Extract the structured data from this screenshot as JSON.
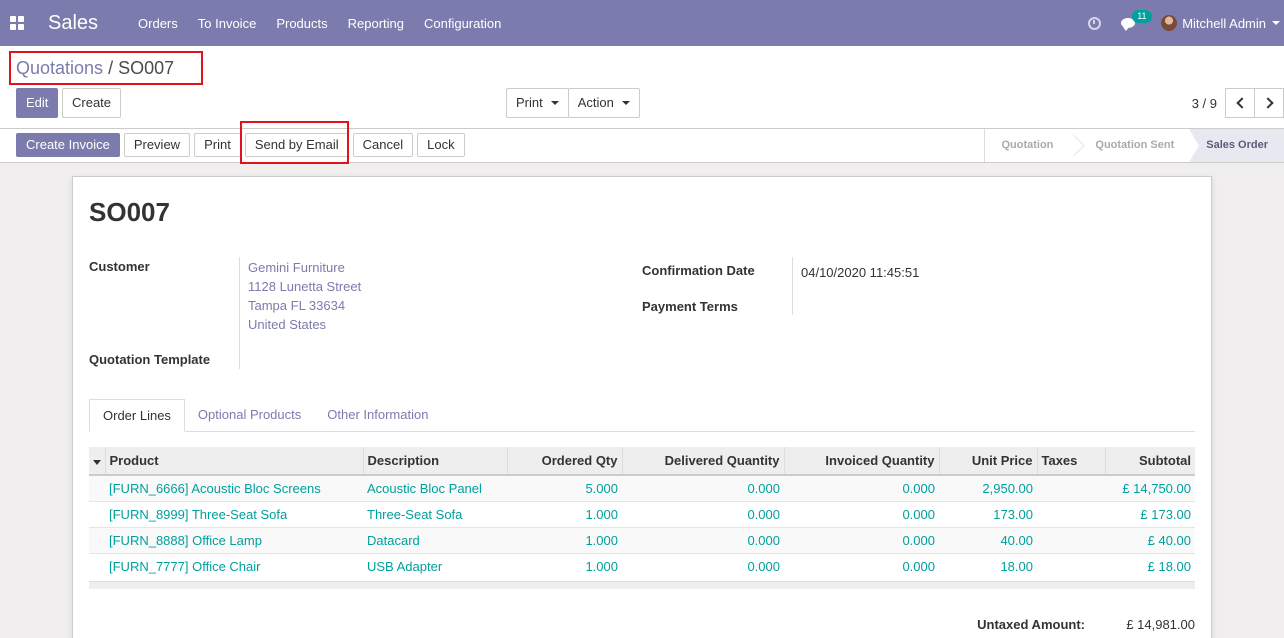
{
  "navbar": {
    "app_name": "Sales",
    "menu": [
      "Orders",
      "To Invoice",
      "Products",
      "Reporting",
      "Configuration"
    ],
    "chat_count": "11",
    "user_name": "Mitchell Admin"
  },
  "breadcrumb": {
    "parent": "Quotations",
    "separator": "/",
    "current": "SO007"
  },
  "toolbar": {
    "edit_label": "Edit",
    "create_label": "Create",
    "print_label": "Print",
    "action_label": "Action",
    "pager_value": "3 / 9"
  },
  "statusbar": {
    "buttons": [
      "Create Invoice",
      "Preview",
      "Print",
      "Send by Email",
      "Cancel",
      "Lock"
    ],
    "stages": [
      "Quotation",
      "Quotation Sent",
      "Sales Order"
    ],
    "active_stage": "Sales Order"
  },
  "form": {
    "title": "SO007",
    "customer_label": "Customer",
    "customer_address": [
      "Gemini Furniture",
      "1128 Lunetta Street",
      "Tampa FL 33634",
      "United States"
    ],
    "template_label": "Quotation Template",
    "confirmation_date_label": "Confirmation Date",
    "confirmation_date": "04/10/2020 11:45:51",
    "payment_terms_label": "Payment Terms"
  },
  "tabs": [
    "Order Lines",
    "Optional Products",
    "Other Information"
  ],
  "order_lines": {
    "headers": [
      "Product",
      "Description",
      "Ordered Qty",
      "Delivered Quantity",
      "Invoiced Quantity",
      "Unit Price",
      "Taxes",
      "Subtotal"
    ],
    "rows": [
      [
        "[FURN_6666] Acoustic Bloc Screens",
        "Acoustic Bloc Panel",
        "5.000",
        "0.000",
        "0.000",
        "2,950.00",
        "",
        "£ 14,750.00"
      ],
      [
        "[FURN_8999] Three-Seat Sofa",
        "Three-Seat Sofa",
        "1.000",
        "0.000",
        "0.000",
        "173.00",
        "",
        "£ 173.00"
      ],
      [
        "[FURN_8888] Office Lamp",
        "Datacard",
        "1.000",
        "0.000",
        "0.000",
        "40.00",
        "",
        "£ 40.00"
      ],
      [
        "[FURN_7777] Office Chair",
        "USB Adapter",
        "1.000",
        "0.000",
        "0.000",
        "18.00",
        "",
        "£ 18.00"
      ]
    ]
  },
  "totals": {
    "untaxed_label": "Untaxed Amount:",
    "untaxed_value": "£ 14,981.00"
  },
  "colors": {
    "brand": "#7c7bad",
    "link": "#00a09d",
    "highlight": "#e0121b"
  }
}
